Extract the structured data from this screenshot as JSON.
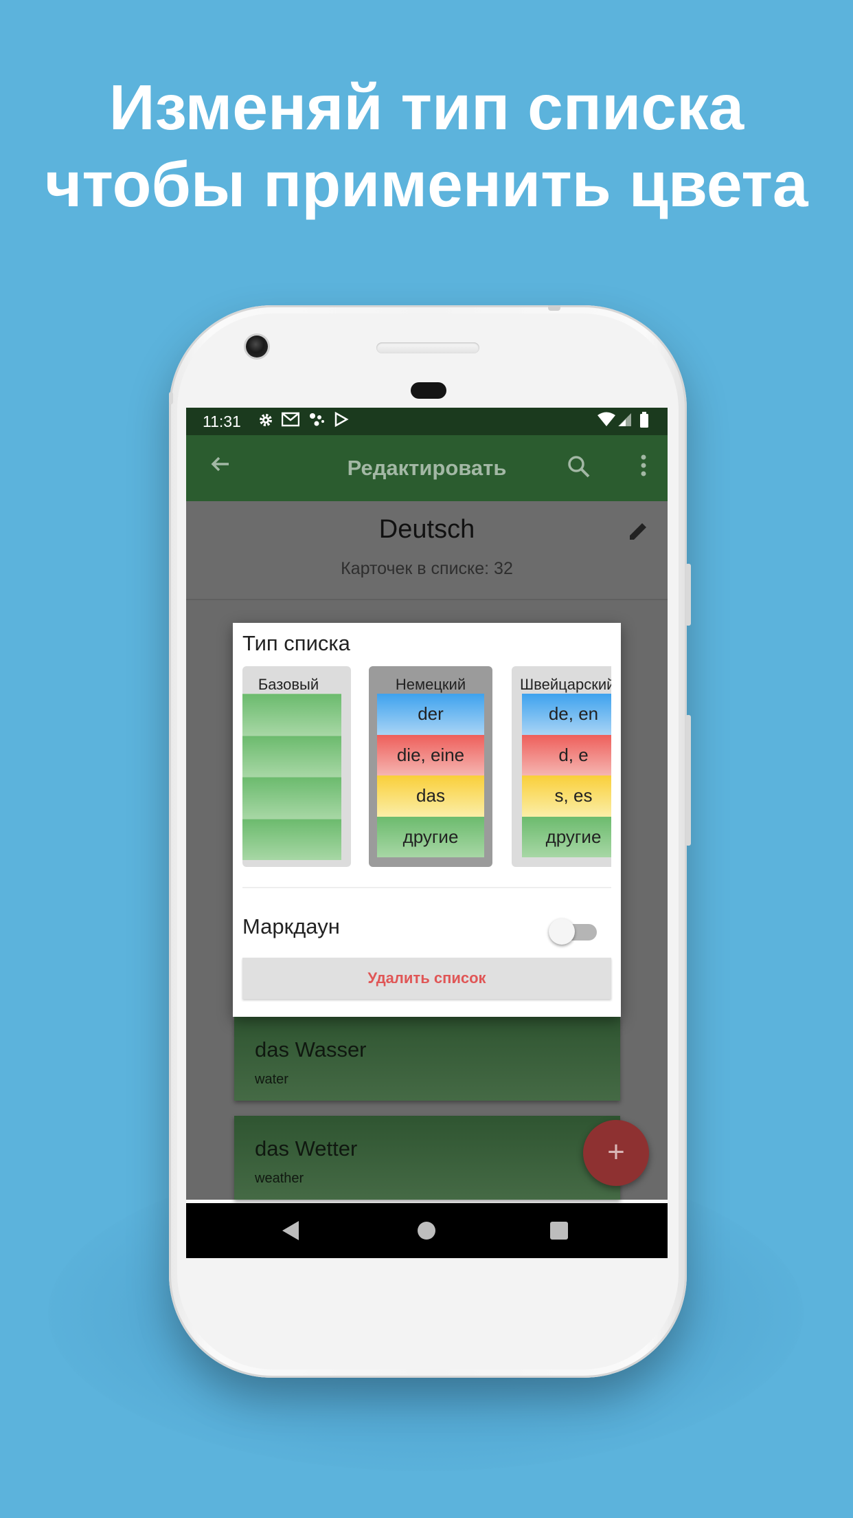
{
  "headline": {
    "line1": "Изменяй тип списка",
    "line2": "чтобы применить цвета"
  },
  "status_bar": {
    "time": "11:31",
    "icons": [
      "settings-icon",
      "gmail-icon",
      "assistant-icon",
      "play-store-icon",
      "wifi-icon",
      "signal-icon",
      "battery-icon"
    ]
  },
  "app_bar": {
    "title": "Редактировать",
    "back_icon": "arrow-back-icon",
    "search_icon": "search-icon",
    "menu_icon": "more-vert-icon"
  },
  "deck": {
    "title": "Deutsch",
    "count_text": "Карточек в списке: 32",
    "edit_icon": "pencil-icon"
  },
  "dialog": {
    "title": "Тип списка",
    "types": [
      {
        "name": "Базовый",
        "selected": false,
        "stripes": [
          "",
          "",
          "",
          ""
        ]
      },
      {
        "name": "Немецкий",
        "selected": true,
        "stripes": [
          "der",
          "die, eine",
          "das",
          "другие"
        ]
      },
      {
        "name": "Швейцарский",
        "selected": false,
        "stripes": [
          "de, en",
          "d, e",
          "s, es",
          "другие"
        ]
      }
    ],
    "markdown_label": "Маркдаун",
    "markdown_enabled": false,
    "delete_button": "Удалить список"
  },
  "cards": [
    {
      "word": "das Wasser",
      "translation": "water"
    },
    {
      "word": "das Wetter",
      "translation": "weather"
    }
  ],
  "fab_icon": "plus-icon",
  "colors": {
    "background": "#5cb3dc",
    "status_bar": "#1b3a1e",
    "app_bar": "#2b5c2f",
    "delete_text": "#e05656",
    "fab": "#8e3131"
  }
}
